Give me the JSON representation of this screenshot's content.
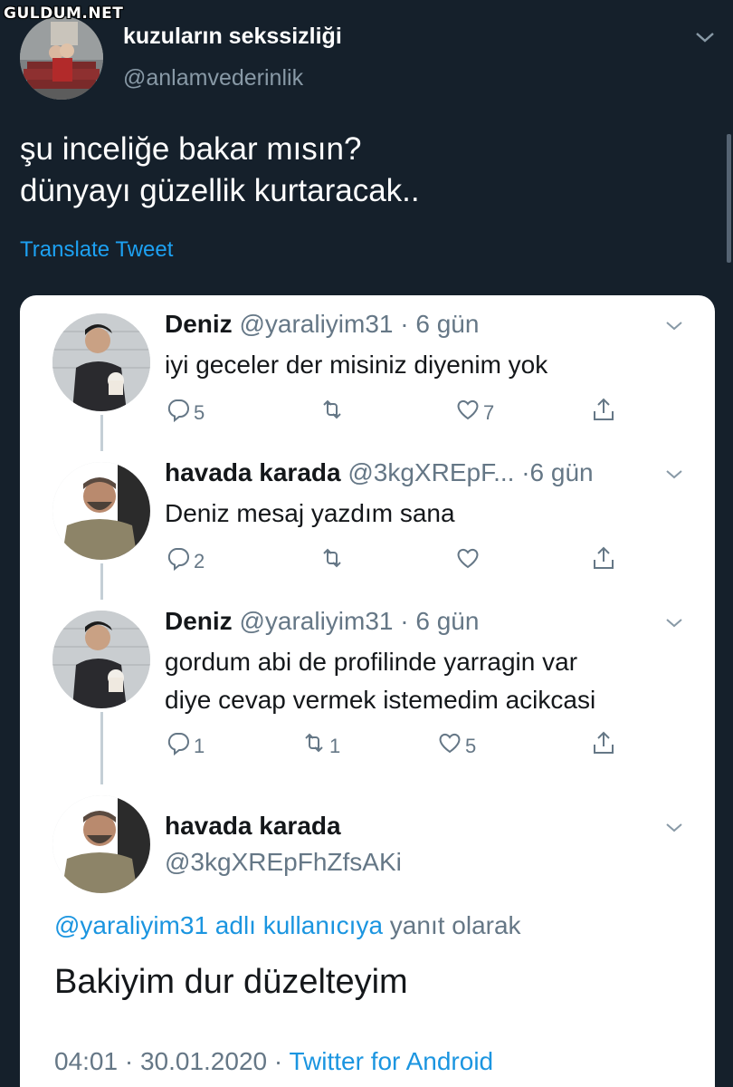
{
  "watermark": "GULDUM.NET",
  "main_tweet": {
    "display_name": "kuzuların sekssizliği",
    "handle": "@anlamvederinlik",
    "text_line1": "şu inceliğe bakar mısın?",
    "text_line2": "dünyayı güzellik kurtaracak..",
    "translate_label": "Translate Tweet"
  },
  "quoted_thread": [
    {
      "name": "Deniz",
      "handle": "@yaraliyim31",
      "time": "· 6 gün",
      "text_lines": [
        "iyi geceler der misiniz diyenim yok"
      ],
      "replies": "5",
      "retweets": "",
      "likes": "7"
    },
    {
      "name": "havada karada",
      "handle": "@3kgXREpF...",
      "time": "·6 gün",
      "text_lines": [
        "Deniz mesaj yazdım sana"
      ],
      "replies": "2",
      "retweets": "",
      "likes": ""
    },
    {
      "name": "Deniz",
      "handle": "@yaraliyim31",
      "time": "· 6 gün",
      "text_lines": [
        "gordum abi de profilinde yarragin var",
        "diye cevap vermek istemedim acikcasi"
      ],
      "replies": "1",
      "retweets": "1",
      "likes": "5"
    }
  ],
  "final_tweet": {
    "name": "havada karada",
    "handle": "@3kgXREpFhZfsAKi",
    "reply_link": "@yaraliyim31 adlı kullanıcıya",
    "reply_suffix": " yanıt olarak",
    "text": "Bakiyim dur düzelteyim",
    "time": "04:01 · 30.01.2020 · ",
    "source": "Twitter for Android"
  },
  "colors": {
    "dark_bg": "#15202b",
    "accent": "#1da1f2",
    "muted": "#657786"
  },
  "icons": [
    "chevron-down-icon",
    "reply-icon",
    "retweet-icon",
    "like-icon",
    "share-icon"
  ]
}
